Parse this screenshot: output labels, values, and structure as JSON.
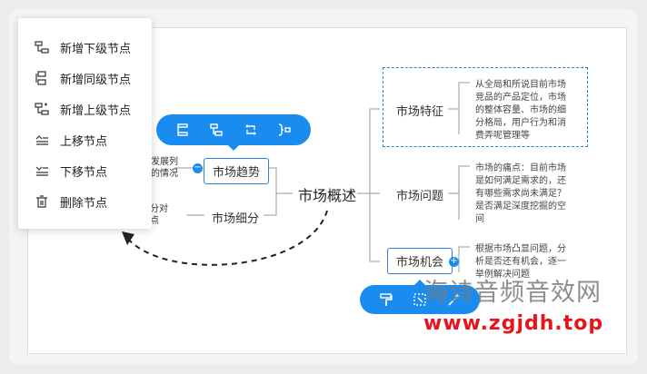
{
  "context_menu": {
    "items": [
      {
        "label": "新增下级节点",
        "icon": "add-child-icon"
      },
      {
        "label": "新增同级节点",
        "icon": "add-sibling-icon"
      },
      {
        "label": "新增上级节点",
        "icon": "add-parent-icon"
      },
      {
        "label": "上移节点",
        "icon": "move-up-icon"
      },
      {
        "label": "下移节点",
        "icon": "move-down-icon"
      },
      {
        "label": "删除节点",
        "icon": "trash-icon"
      }
    ]
  },
  "mindmap": {
    "root": "市场概述",
    "left": [
      {
        "label": "市场趋势",
        "partial_text": [
          "发展列",
          "的情况"
        ]
      },
      {
        "label": "市场细分",
        "partial_text": [
          "分对",
          "点"
        ]
      }
    ],
    "right": [
      {
        "label": "市场特征",
        "desc": "从全局和所说目前市场竞品的产品定位，市场的整体容量、市场的细分格局，用户行为和消费弄呢管理等"
      },
      {
        "label": "市场问题",
        "desc": "市场的痛点：目前市场是如何满足需求的，还有哪些需求尚未满足？是否满足深度挖掘的空间"
      },
      {
        "label": "市场机会",
        "desc": "根据市场凸显问题，分析是否还有机会，逐一举例解决问题"
      }
    ]
  },
  "toolbar_top": {
    "icons": [
      "layout-left-icon",
      "layout-tree-icon",
      "layout-loop-icon",
      "layout-bracket-icon"
    ]
  },
  "toolbar_bottom": {
    "icons": [
      "paint-roller-icon",
      "select-icon",
      "magic-wand-icon"
    ]
  },
  "watermark": {
    "line1": "海诗音频音效网",
    "line2": "www.zgjdh.top"
  },
  "colors": {
    "accent": "#1a8cf0",
    "node_border": "#2f80d0",
    "watermark_red": "#e8141c"
  }
}
